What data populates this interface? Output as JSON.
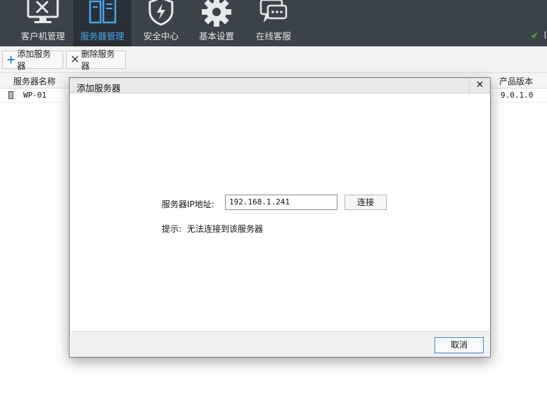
{
  "nav": {
    "items": [
      {
        "label": "客户机管理",
        "icon": "client-tools-icon"
      },
      {
        "label": "服务器管理",
        "icon": "server-icon",
        "active": true
      },
      {
        "label": "安全中心",
        "icon": "shield-bolt-icon"
      },
      {
        "label": "基本设置",
        "icon": "gear-icon"
      },
      {
        "label": "在线客服",
        "icon": "chat-icon"
      }
    ],
    "status_text": "[",
    "accent_color": "#4aa3e8",
    "bar_color": "#3b4249"
  },
  "toolbar": {
    "add_label": "添加服务器",
    "delete_label": "删除服务器"
  },
  "table": {
    "columns": [
      "服务器名称",
      "产品版本"
    ],
    "rows": [
      {
        "name": "WP-01",
        "version": "9.0.1.0"
      }
    ]
  },
  "dialog": {
    "title": "添加服务器",
    "close_glyph": "✕",
    "ip_label": "服务器IP地址:",
    "ip_value": "192.168.1.241",
    "connect_label": "连接",
    "hint_label": "提示:",
    "hint_text": "无法连接到该服务器",
    "cancel_label": "取消"
  }
}
